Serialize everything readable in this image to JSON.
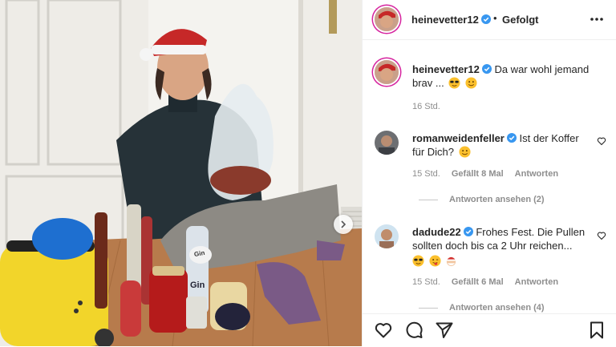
{
  "header": {
    "username": "heinevetter12",
    "separator": "•",
    "follow_state": "Gefolgt"
  },
  "caption": {
    "username": "heinevetter12",
    "text": "Da war wohl jemand brav ...",
    "time": "16 Std."
  },
  "comments": [
    {
      "username": "romanweidenfeller",
      "text": "Ist der Koffer für Dich?",
      "time": "15 Std.",
      "likes": "Gefällt 8 Mal",
      "reply": "Antworten",
      "view_replies": "Antworten ansehen (2)"
    },
    {
      "username": "dadude22",
      "text": "Frohes Fest. Die Pullen sollten doch bis ca 2 Uhr reichen...",
      "time": "15 Std.",
      "likes": "Gefällt 6 Mal",
      "reply": "Antworten",
      "view_replies": "Antworten ansehen (4)"
    }
  ],
  "photo_labels": {
    "gin_tag": "Gin",
    "gin_label": "Gin"
  },
  "icons": {
    "verified": "verified-badge-icon",
    "more": "more-horizontal-icon",
    "like": "heart-icon",
    "comment": "comment-icon",
    "share": "paper-plane-icon",
    "save": "bookmark-icon",
    "next": "chevron-right-icon"
  },
  "colors": {
    "verified_blue": "#3897f0",
    "meta_gray": "#8e8e8e",
    "text": "#262626",
    "divider": "#efefef"
  }
}
